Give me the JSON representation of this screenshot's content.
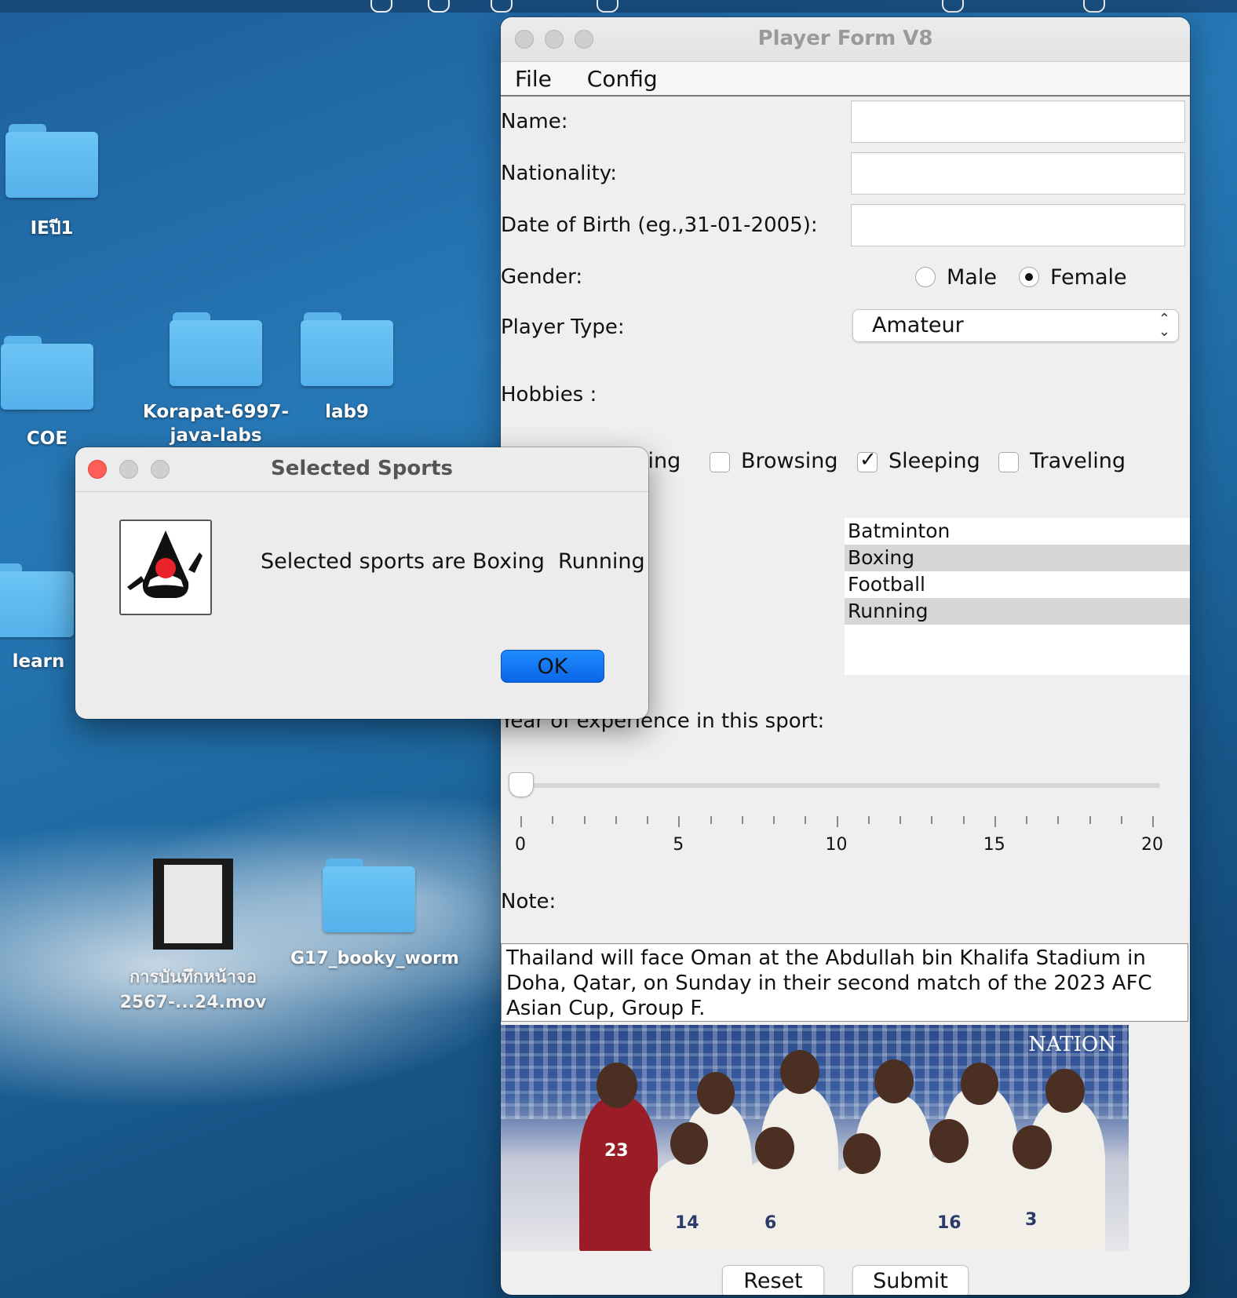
{
  "desktop": {
    "items": [
      {
        "label": "IEปี1"
      },
      {
        "label": "COE"
      },
      {
        "label": "Korapat-6997-java-labs"
      },
      {
        "label": "lab9"
      },
      {
        "label": "learn"
      },
      {
        "label": "การบันทึกหน้าจอ 2567-...24.mov"
      },
      {
        "label": "G17_booky_worm"
      }
    ]
  },
  "window": {
    "title": "Player Form V8",
    "menu": [
      "File",
      "Config"
    ],
    "form": {
      "name_label": "Name:",
      "name_value": "",
      "nationality_label": "Nationality:",
      "nationality_value": "",
      "dob_label": "Date of Birth (eg.,31-01-2005):",
      "dob_value": "",
      "gender_label": "Gender:",
      "gender_options": [
        "Male",
        "Female"
      ],
      "gender_selected": "Female",
      "player_type_label": "Player Type:",
      "player_type_value": "Amateur",
      "hobbies_label": "Hobbies :",
      "hobbies": [
        {
          "label": "Reading",
          "visible_text": "ling",
          "checked": false
        },
        {
          "label": "Browsing",
          "checked": false
        },
        {
          "label": "Sleeping",
          "checked": true
        },
        {
          "label": "Traveling",
          "checked": false
        }
      ],
      "sports": [
        {
          "label": "Batminton",
          "selected": false
        },
        {
          "label": "Boxing",
          "selected": true
        },
        {
          "label": "Football",
          "selected": false
        },
        {
          "label": "Running",
          "selected": true
        }
      ],
      "experience_label": "Year of experience in this sport:",
      "experience_value": 0,
      "slider_ticks": [
        "0",
        "5",
        "10",
        "15",
        "20"
      ],
      "note_label": "Note:",
      "note_text": "Thailand will face Oman at the Abdullah bin Khalifa Stadium in Doha, Qatar, on Sunday in their second match of the 2023 AFC Asian Cup, Group F.",
      "photo_logo": "NATION",
      "reset_label": "Reset",
      "submit_label": "Submit"
    }
  },
  "dialog": {
    "title": "Selected Sports",
    "message": "Selected sports are Boxing  Running",
    "ok_label": "OK",
    "icon": "java-duke-icon"
  },
  "colors": {
    "close_red": "#fe5f57",
    "ok_blue": "#0a66e6",
    "window_bg": "#efefef"
  }
}
